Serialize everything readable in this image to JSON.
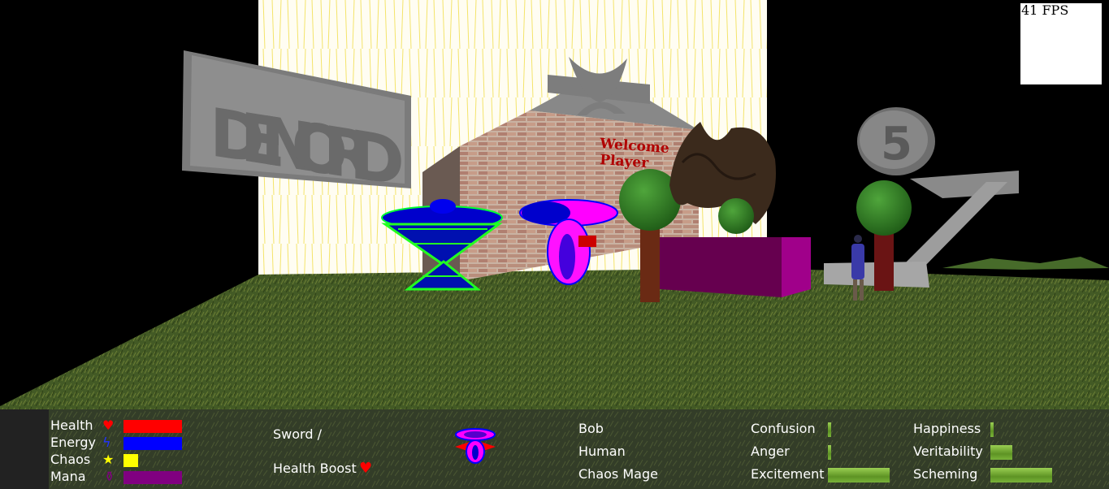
{
  "scene": {
    "sign_letters": "DENORD",
    "welcome_line1": "Welcome",
    "welcome_line2": "Player",
    "coin_label": "5"
  },
  "fps": "41 FPS",
  "stats": [
    {
      "label": "Health",
      "icon": "heart-icon",
      "color": "#ff0000",
      "fill": 1.0
    },
    {
      "label": "Energy",
      "icon": "lightning-icon",
      "color": "#0000ff",
      "fill": 1.0
    },
    {
      "label": "Chaos",
      "icon": "star-icon",
      "color": "#ffff00",
      "fill": 0.25
    },
    {
      "label": "Mana",
      "icon": "potion-icon",
      "color": "#800080",
      "fill": 1.0
    }
  ],
  "equipment": {
    "weapon": "Sword /",
    "item": "Health Boost",
    "item_icon": "heart-icon"
  },
  "character": {
    "name": "Bob",
    "race": "Human",
    "class": "Chaos Mage"
  },
  "emotions": [
    {
      "label": "Confusion",
      "level": 0.05
    },
    {
      "label": "Anger",
      "level": 0.05
    },
    {
      "label": "Excitement",
      "level": 1.0
    },
    {
      "label": "Happiness",
      "level": 0.05
    },
    {
      "label": "Veritability",
      "level": 0.35
    },
    {
      "label": "Scheming",
      "level": 1.0
    }
  ]
}
